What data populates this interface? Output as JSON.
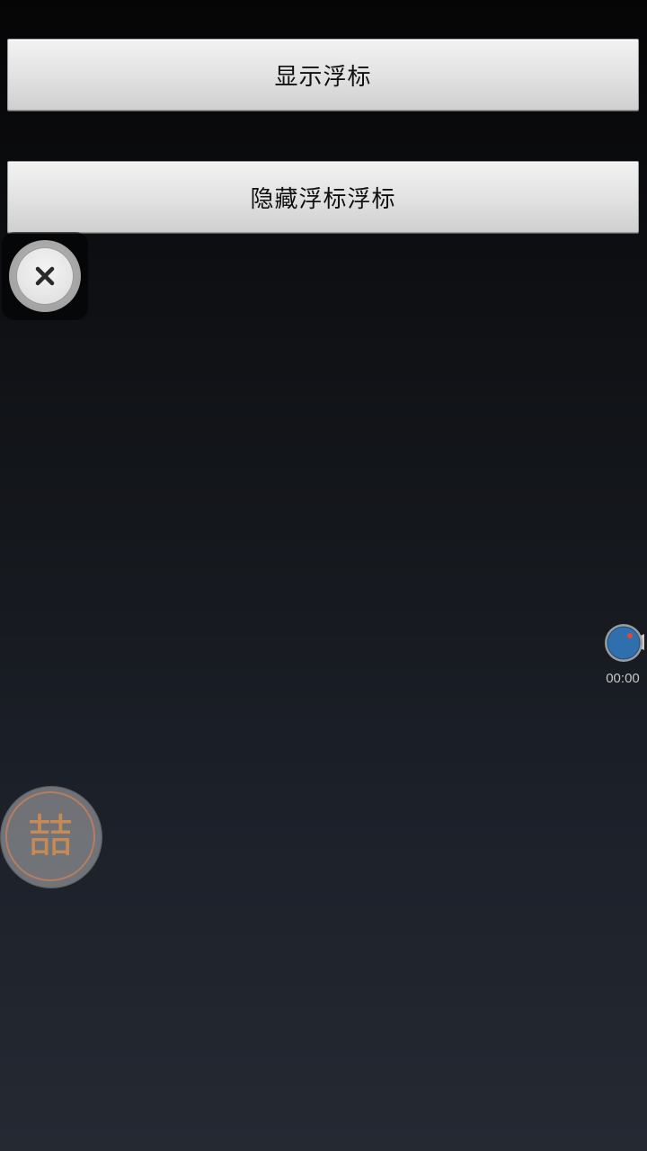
{
  "buttons": {
    "show_label": "显示浮标",
    "hide_label": "隐藏浮标浮标"
  },
  "floats": {
    "close_icon": "close-icon",
    "recorder_icon": "record-camera-icon",
    "recorder_time": "00:00",
    "xi_glyph": "喆"
  },
  "colors": {
    "recorder_blue": "#2f6fae",
    "recorder_dot": "#e0483a",
    "xi_orange": "#c88a55"
  }
}
